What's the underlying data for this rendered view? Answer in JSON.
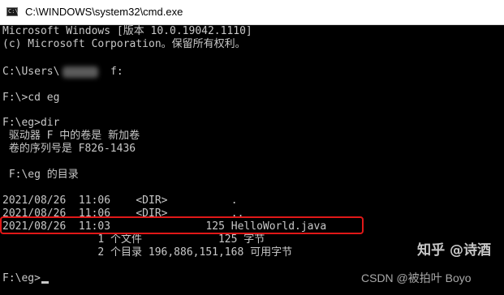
{
  "window": {
    "title": "C:\\WINDOWS\\system32\\cmd.exe",
    "icon": "cmd-icon",
    "icon_glyph": "C:\\"
  },
  "console": {
    "lines": [
      "Microsoft Windows [版本 10.0.19042.1110]",
      "(c) Microsoft Corporation。保留所有权利。",
      "",
      "C:\\Users\\        f:",
      "",
      "F:\\>cd eg",
      "",
      "F:\\eg>dir",
      " 驱动器 F 中的卷是 新加卷",
      " 卷的序列号是 F826-1436",
      "",
      " F:\\eg 的目录",
      "",
      "2021/08/26  11:06    <DIR>          .",
      "2021/08/26  11:06    <DIR>          ..",
      "2021/08/26  11:03               125 HelloWorld.java",
      "               1 个文件            125 字节",
      "               2 个目录 196,886,151,168 可用字节",
      "",
      "F:\\eg>"
    ]
  },
  "watermark": {
    "zhihu": "知乎 @诗酒",
    "csdn": "CSDN @被拍叶 Boyo"
  },
  "colors": {
    "console_bg": "#000000",
    "console_fg": "#c8c8c8",
    "highlight": "#e01818"
  }
}
